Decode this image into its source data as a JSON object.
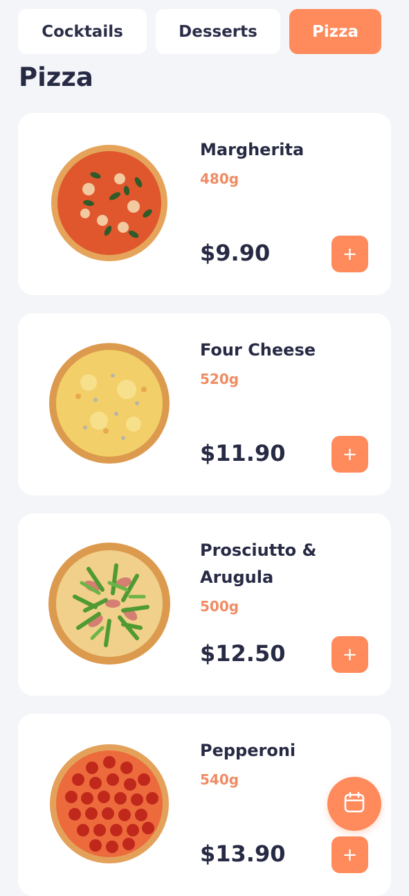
{
  "tabs": [
    {
      "label": "Cocktails",
      "active": false
    },
    {
      "label": "Desserts",
      "active": false
    },
    {
      "label": "Pizza",
      "active": true
    }
  ],
  "page_title": "Pizza",
  "products": [
    {
      "name": "Margherita",
      "weight": "480g",
      "price": "$9.90",
      "add_label": "+",
      "image_icon": "margherita-pizza"
    },
    {
      "name": "Four Cheese",
      "weight": "520g",
      "price": "$11.90",
      "add_label": "+",
      "image_icon": "four-cheese-pizza"
    },
    {
      "name": "Prosciutto & Arugula",
      "weight": "500g",
      "price": "$12.50",
      "add_label": "+",
      "image_icon": "prosciutto-arugula-pizza"
    },
    {
      "name": "Pepperoni",
      "weight": "540g",
      "price": "$13.90",
      "add_label": "+",
      "image_icon": "pepperoni-pizza"
    }
  ],
  "fab_icon": "calendar-icon",
  "colors": {
    "accent": "#ff8a5c",
    "weight_text": "#f08c64",
    "text": "#272a44",
    "background": "#f4f5f9"
  }
}
